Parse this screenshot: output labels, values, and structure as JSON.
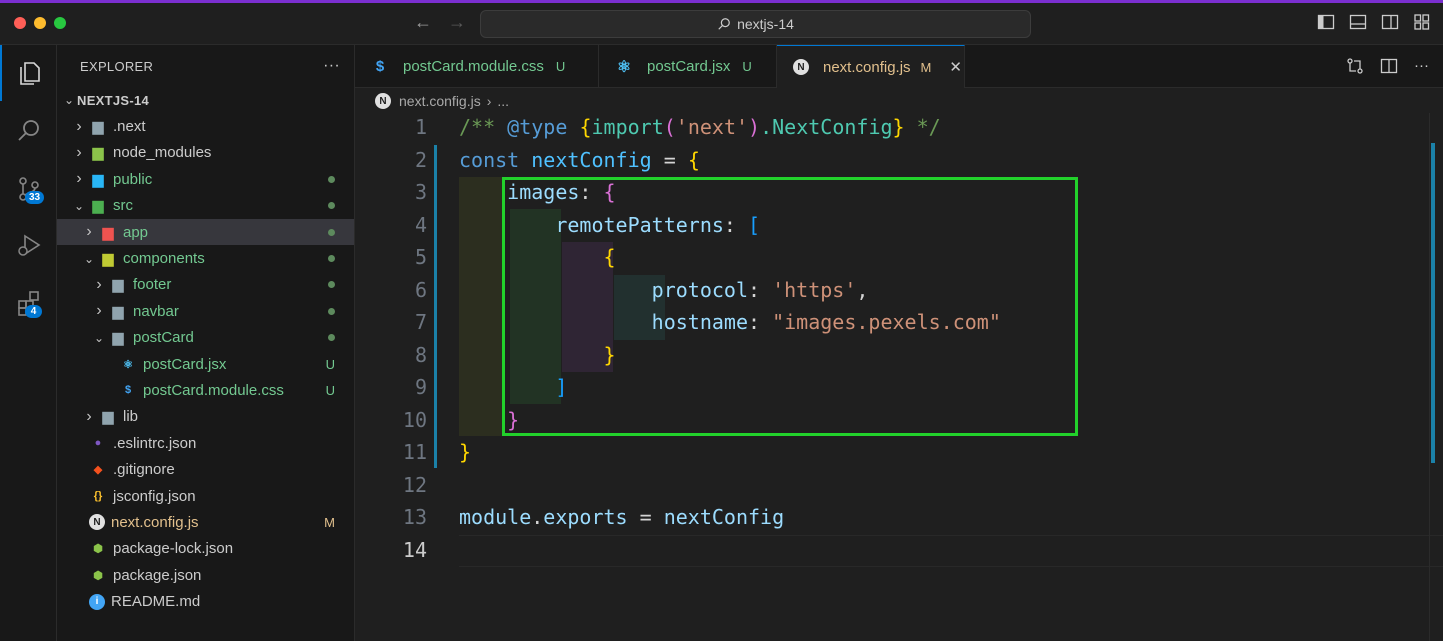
{
  "window": {
    "search_text": "nextjs-14"
  },
  "activity_bar": {
    "items": [
      {
        "name": "explorer",
        "icon": "files-icon",
        "active": true
      },
      {
        "name": "search",
        "icon": "search-icon"
      },
      {
        "name": "source-control",
        "icon": "source-control-icon",
        "badge": "33"
      },
      {
        "name": "run-debug",
        "icon": "run-debug-icon"
      },
      {
        "name": "extensions",
        "icon": "extensions-icon",
        "badge": "4"
      }
    ]
  },
  "sidebar": {
    "title": "EXPLORER",
    "more": "···",
    "root": "NEXTJS-14",
    "tree": [
      {
        "label": ".next",
        "depth": 1,
        "kind": "folder",
        "expanded": false,
        "icon": "folder-icon",
        "status": ""
      },
      {
        "label": "node_modules",
        "depth": 1,
        "kind": "folder",
        "expanded": false,
        "icon": "node-folder-icon",
        "status": ""
      },
      {
        "label": "public",
        "depth": 1,
        "kind": "folder",
        "expanded": false,
        "icon": "public-folder-icon",
        "status": "dot",
        "color": "green"
      },
      {
        "label": "src",
        "depth": 1,
        "kind": "folder",
        "expanded": true,
        "icon": "src-folder-icon",
        "status": "dot",
        "color": "green"
      },
      {
        "label": "app",
        "depth": 2,
        "kind": "folder",
        "expanded": false,
        "icon": "app-folder-icon",
        "status": "dot",
        "color": "green",
        "selected": true
      },
      {
        "label": "components",
        "depth": 2,
        "kind": "folder",
        "expanded": true,
        "icon": "components-folder-icon",
        "status": "dot",
        "color": "green"
      },
      {
        "label": "footer",
        "depth": 3,
        "kind": "folder",
        "expanded": false,
        "icon": "folder-icon",
        "status": "dot",
        "color": "green"
      },
      {
        "label": "navbar",
        "depth": 3,
        "kind": "folder",
        "expanded": false,
        "icon": "folder-icon",
        "status": "dot",
        "color": "green"
      },
      {
        "label": "postCard",
        "depth": 3,
        "kind": "folder",
        "expanded": true,
        "icon": "folder-open-icon",
        "status": "dot",
        "color": "green"
      },
      {
        "label": "postCard.jsx",
        "depth": 4,
        "kind": "file",
        "icon": "react-icon",
        "status": "U",
        "color": "green"
      },
      {
        "label": "postCard.module.css",
        "depth": 4,
        "kind": "file",
        "icon": "css-icon",
        "status": "U",
        "color": "green"
      },
      {
        "label": "lib",
        "depth": 2,
        "kind": "folder",
        "expanded": false,
        "icon": "folder-icon",
        "status": ""
      },
      {
        "label": ".eslintrc.json",
        "depth": 1,
        "kind": "file",
        "icon": "eslint-icon",
        "status": ""
      },
      {
        "label": ".gitignore",
        "depth": 1,
        "kind": "file",
        "icon": "git-icon",
        "status": ""
      },
      {
        "label": "jsconfig.json",
        "depth": 1,
        "kind": "file",
        "icon": "jsconfig-icon",
        "status": ""
      },
      {
        "label": "next.config.js",
        "depth": 1,
        "kind": "file",
        "icon": "next-icon",
        "status": "M",
        "color": "gold"
      },
      {
        "label": "package-lock.json",
        "depth": 1,
        "kind": "file",
        "icon": "node-icon",
        "status": ""
      },
      {
        "label": "package.json",
        "depth": 1,
        "kind": "file",
        "icon": "node-icon",
        "status": ""
      },
      {
        "label": "README.md",
        "depth": 1,
        "kind": "file",
        "icon": "info-icon",
        "status": ""
      }
    ]
  },
  "tabs": [
    {
      "label": "postCard.module.css",
      "icon": "css-icon",
      "status": "U",
      "active": false
    },
    {
      "label": "postCard.jsx",
      "icon": "react-icon",
      "status": "U",
      "active": false
    },
    {
      "label": "next.config.js",
      "icon": "next-icon",
      "status": "M",
      "active": true,
      "close": "✕"
    }
  ],
  "breadcrumb": {
    "file": "next.config.js",
    "sep": "›",
    "rest": "..."
  },
  "editor": {
    "current_line": 14,
    "lines": [
      [
        [
          "/** ",
          "comment"
        ],
        [
          "@type",
          "kw"
        ],
        [
          " ",
          "comment"
        ],
        [
          "{",
          "br1"
        ],
        [
          "import",
          "fn"
        ],
        [
          "(",
          "br2"
        ],
        [
          "'next'",
          "str"
        ],
        [
          ")",
          "br2"
        ],
        [
          ".NextConfig",
          "fn"
        ],
        [
          "}",
          "br1"
        ],
        [
          " */",
          "comment"
        ]
      ],
      [
        [
          "const",
          "kw"
        ],
        [
          " ",
          "op"
        ],
        [
          "nextConfig",
          "var"
        ],
        [
          " = ",
          "op"
        ],
        [
          "{",
          "br1"
        ]
      ],
      [
        [
          "    ",
          "op"
        ],
        [
          "images",
          "prop"
        ],
        [
          ": ",
          "op"
        ],
        [
          "{",
          "br2"
        ]
      ],
      [
        [
          "        ",
          "op"
        ],
        [
          "remotePatterns",
          "prop"
        ],
        [
          ": ",
          "op"
        ],
        [
          "[",
          "br3"
        ]
      ],
      [
        [
          "            ",
          "op"
        ],
        [
          "{",
          "br1"
        ]
      ],
      [
        [
          "                ",
          "op"
        ],
        [
          "protocol",
          "prop"
        ],
        [
          ": ",
          "op"
        ],
        [
          "'https'",
          "str"
        ],
        [
          ",",
          "op"
        ]
      ],
      [
        [
          "                ",
          "op"
        ],
        [
          "hostname",
          "prop"
        ],
        [
          ": ",
          "op"
        ],
        [
          "\"images.pexels.com\"",
          "str"
        ]
      ],
      [
        [
          "            ",
          "op"
        ],
        [
          "}",
          "br1"
        ]
      ],
      [
        [
          "        ",
          "op"
        ],
        [
          "]",
          "br3"
        ]
      ],
      [
        [
          "    ",
          "op"
        ],
        [
          "}",
          "br2"
        ]
      ],
      [
        [
          "}",
          "br1"
        ]
      ],
      [],
      [
        [
          "module",
          "prop"
        ],
        [
          ".",
          "op"
        ],
        [
          "exports",
          "prop"
        ],
        [
          " = ",
          "op"
        ],
        [
          "nextConfig",
          "prop"
        ]
      ],
      []
    ]
  },
  "colors": {
    "highlight_box": "#22d12b",
    "accent": "#0078d4",
    "untracked": "#73c991",
    "modified": "#e2c08d"
  }
}
